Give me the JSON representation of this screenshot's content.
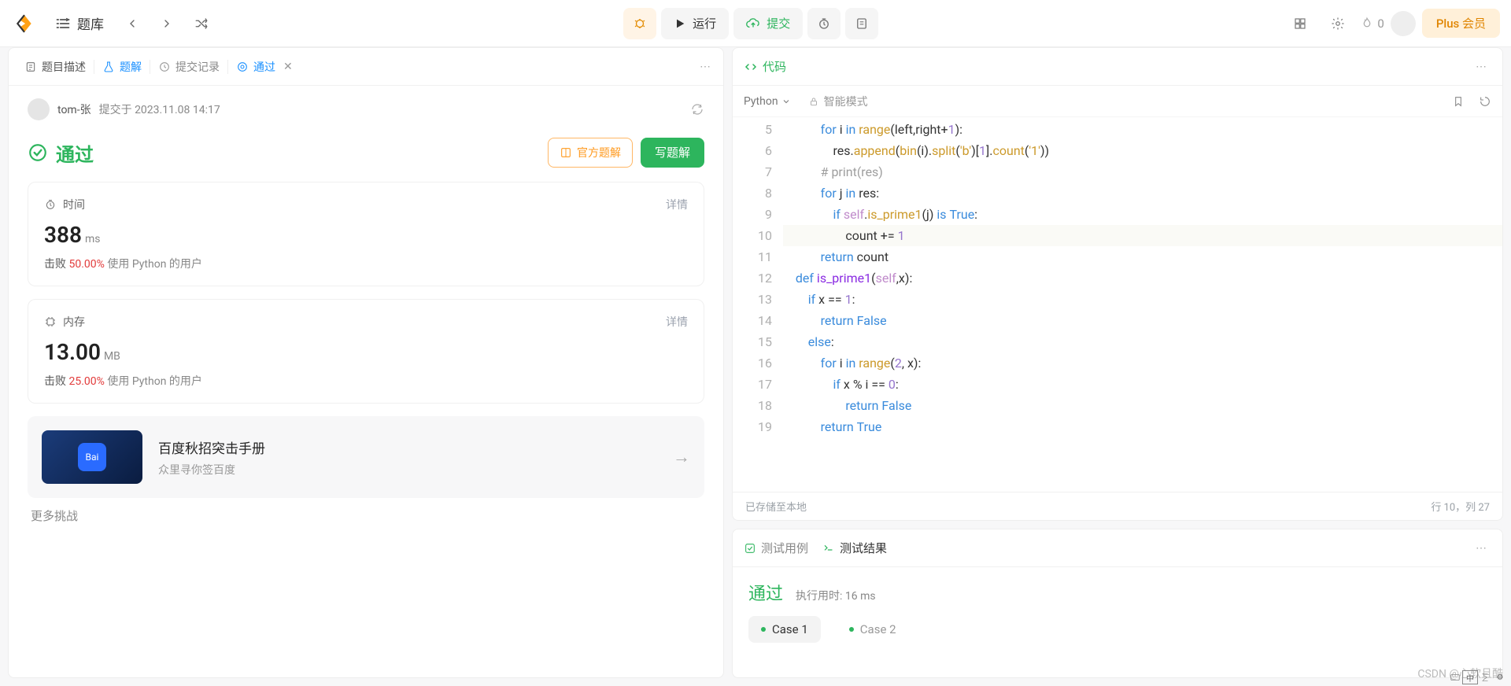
{
  "topbar": {
    "tiku_label": "题库",
    "run_label": "运行",
    "submit_label": "提交",
    "streak_count": "0",
    "plus_label": "Plus 会员"
  },
  "leftTabs": {
    "desc": "题目描述",
    "solution": "题解",
    "submissions": "提交记录",
    "passed": "通过"
  },
  "submission": {
    "user": "tom-张",
    "meta_label": "提交于",
    "date": "2023.11.08 14:17"
  },
  "result": {
    "pass_title": "通过",
    "official_btn": "官方题解",
    "write_btn": "写题解"
  },
  "timeCard": {
    "title": "时间",
    "details": "详情",
    "value": "388",
    "unit": "ms",
    "beat_label": "击败",
    "percent": "50.00%",
    "tail": "使用 Python 的用户"
  },
  "memCard": {
    "title": "内存",
    "details": "详情",
    "value": "13.00",
    "unit": "MB",
    "beat_label": "击败",
    "percent": "25.00%",
    "tail": "使用 Python 的用户"
  },
  "ad": {
    "title": "百度秋招突击手册",
    "subtitle": "众里寻你签百度"
  },
  "moreChallenges": "更多挑战",
  "codeHead": {
    "label": "代码"
  },
  "codeBar": {
    "language": "Python",
    "ai_mode": "智能模式"
  },
  "codeStatus": {
    "saved": "已存储至本地",
    "cursor": "行 10，列 27"
  },
  "code": {
    "first_line_no": 5,
    "highlight_index": 5,
    "lines": [
      [
        [
          "            ",
          ""
        ],
        [
          "for",
          "kw"
        ],
        [
          " i ",
          ""
        ],
        [
          "in",
          "kw"
        ],
        [
          " ",
          ""
        ],
        [
          "range",
          "call"
        ],
        [
          "(left,right+",
          ""
        ],
        [
          "1",
          "num"
        ],
        [
          "):",
          ""
        ]
      ],
      [
        [
          "                res.",
          ""
        ],
        [
          "append",
          "call"
        ],
        [
          "(",
          ""
        ],
        [
          "bin",
          "call"
        ],
        [
          "(i).",
          ""
        ],
        [
          "split",
          "call"
        ],
        [
          "(",
          ""
        ],
        [
          "'b'",
          "str"
        ],
        [
          ")[",
          ""
        ],
        [
          "1",
          "num"
        ],
        [
          "].",
          ""
        ],
        [
          "count",
          "call"
        ],
        [
          "(",
          ""
        ],
        [
          "'1'",
          "str"
        ],
        [
          "))",
          ""
        ]
      ],
      [
        [
          "            ",
          ""
        ],
        [
          "# print(res)",
          "cmt"
        ]
      ],
      [
        [
          "            ",
          ""
        ],
        [
          "for",
          "kw"
        ],
        [
          " j ",
          ""
        ],
        [
          "in",
          "kw"
        ],
        [
          " res:",
          ""
        ]
      ],
      [
        [
          "                ",
          ""
        ],
        [
          "if",
          "kw"
        ],
        [
          " ",
          ""
        ],
        [
          "self",
          "self"
        ],
        [
          ".",
          ""
        ],
        [
          "is_prime1",
          "call"
        ],
        [
          "(j) ",
          ""
        ],
        [
          "is",
          "kw"
        ],
        [
          " ",
          ""
        ],
        [
          "True",
          "bool"
        ],
        [
          ":",
          ""
        ]
      ],
      [
        [
          "                    count += ",
          ""
        ],
        [
          "1",
          "num"
        ]
      ],
      [
        [
          "            ",
          ""
        ],
        [
          "return",
          "kw"
        ],
        [
          " count",
          ""
        ]
      ],
      [
        [
          "    ",
          ""
        ],
        [
          "def",
          "def"
        ],
        [
          " ",
          ""
        ],
        [
          "is_prime1",
          "fn"
        ],
        [
          "(",
          ""
        ],
        [
          "self",
          "self"
        ],
        [
          ",x):",
          ""
        ]
      ],
      [
        [
          "        ",
          ""
        ],
        [
          "if",
          "kw"
        ],
        [
          " x == ",
          ""
        ],
        [
          "1",
          "num"
        ],
        [
          ":",
          ""
        ]
      ],
      [
        [
          "            ",
          ""
        ],
        [
          "return",
          "kw"
        ],
        [
          " ",
          ""
        ],
        [
          "False",
          "bool"
        ]
      ],
      [
        [
          "        ",
          ""
        ],
        [
          "else",
          "kw"
        ],
        [
          ":",
          ""
        ]
      ],
      [
        [
          "            ",
          ""
        ],
        [
          "for",
          "kw"
        ],
        [
          " i ",
          ""
        ],
        [
          "in",
          "kw"
        ],
        [
          " ",
          ""
        ],
        [
          "range",
          "call"
        ],
        [
          "(",
          ""
        ],
        [
          "2",
          "num"
        ],
        [
          ", x):",
          ""
        ]
      ],
      [
        [
          "                ",
          ""
        ],
        [
          "if",
          "kw"
        ],
        [
          " x % i == ",
          ""
        ],
        [
          "0",
          "num"
        ],
        [
          ":",
          ""
        ]
      ],
      [
        [
          "                    ",
          ""
        ],
        [
          "return",
          "kw"
        ],
        [
          " ",
          ""
        ],
        [
          "False",
          "bool"
        ]
      ],
      [
        [
          "            ",
          ""
        ],
        [
          "return",
          "kw"
        ],
        [
          " ",
          ""
        ],
        [
          "True",
          "bool"
        ]
      ]
    ]
  },
  "testPanel": {
    "tab_cases": "测试用例",
    "tab_result": "测试结果",
    "pass": "通过",
    "runtime": "执行用时: 16 ms",
    "cases": [
      "Case 1",
      "Case 2"
    ],
    "active_case": 0
  },
  "watermark": "CSDN @心软且酷"
}
